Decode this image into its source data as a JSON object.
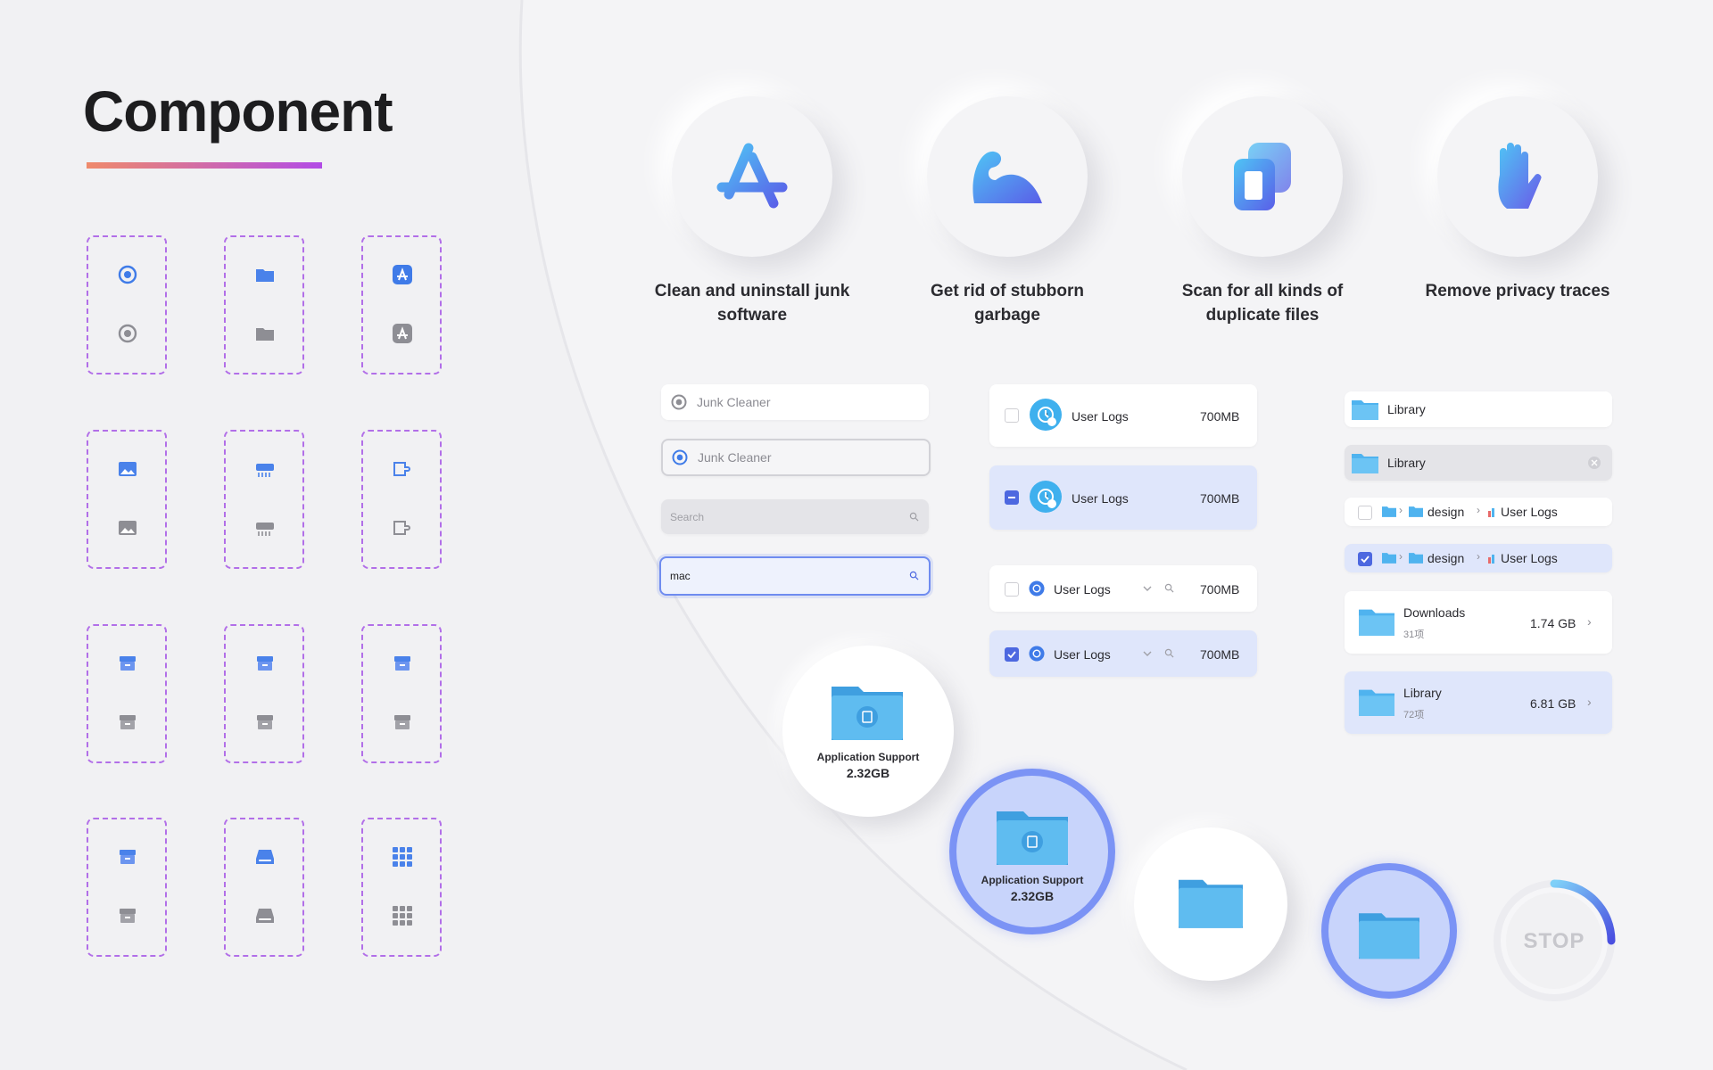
{
  "title": "Component",
  "features": [
    {
      "label_line1": "Clean and uninstall junk",
      "label_line2": "software",
      "icon": "appstore-icon"
    },
    {
      "label_line1": "Get rid of stubborn",
      "label_line2": "garbage",
      "icon": "dinosaur-icon"
    },
    {
      "label_line1": "Scan for all kinds of",
      "label_line2": "duplicate files",
      "icon": "duplicate-icon"
    },
    {
      "label_line1": "Remove privacy traces",
      "label_line2": "",
      "icon": "hand-icon"
    }
  ],
  "inputs": {
    "junk_cleaner_1": "Junk Cleaner",
    "junk_cleaner_2": "Junk Cleaner",
    "search_placeholder": "Search",
    "search_value": "mac"
  },
  "user_logs": {
    "label": "User Logs",
    "size": "700MB"
  },
  "library_items": {
    "library": "Library",
    "design": "design",
    "user_logs": "User Logs"
  },
  "folders": [
    {
      "name": "Downloads",
      "count": "31项",
      "size": "1.74 GB"
    },
    {
      "name": "Library",
      "count": "72项",
      "size": "6.81 GB"
    }
  ],
  "app_support": {
    "name": "Application Support",
    "size": "2.32GB"
  },
  "stop_label": "STOP",
  "colors": {
    "accent": "#4d68e0",
    "selected_bg": "#dfe6fb",
    "dashed_border": "#b26fe8"
  }
}
